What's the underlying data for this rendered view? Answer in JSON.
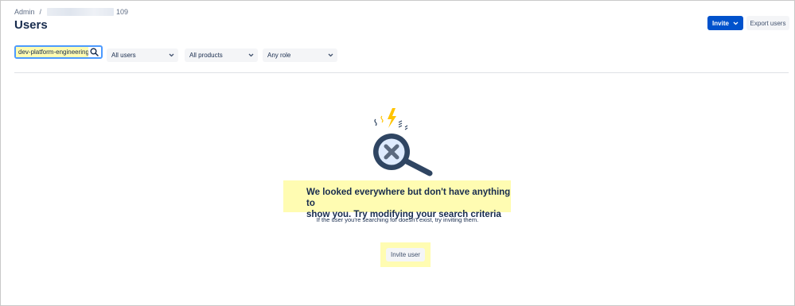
{
  "breadcrumb": {
    "root": "Admin",
    "separator": "/",
    "org_suffix": "109"
  },
  "page": {
    "title": "Users"
  },
  "header_actions": {
    "invite_label": "Invite",
    "export_label": "Export users"
  },
  "filters": {
    "search_value": "dev-platform-engineering",
    "user_filter": "All users",
    "product_filter": "All products",
    "role_filter": "Any role"
  },
  "empty_state": {
    "heading_line1": "We looked everywhere but don't have anything to",
    "heading_line2": "show you. Try modifying your search criteria",
    "description": "If the user you're searching for doesn't exist, try inviting them.",
    "action_label": "Invite user"
  },
  "colors": {
    "primary": "#0052cc",
    "highlight": "#fffcb2",
    "focus": "#4c9aff",
    "text": "#172b4d",
    "lens_dark": "#2f4562",
    "lens_fill": "#deebff",
    "spark": "#ffc400"
  },
  "icons": {
    "search": "search-icon",
    "chevron": "chevron-down-icon",
    "illustration": "magnifier-x-icon"
  }
}
